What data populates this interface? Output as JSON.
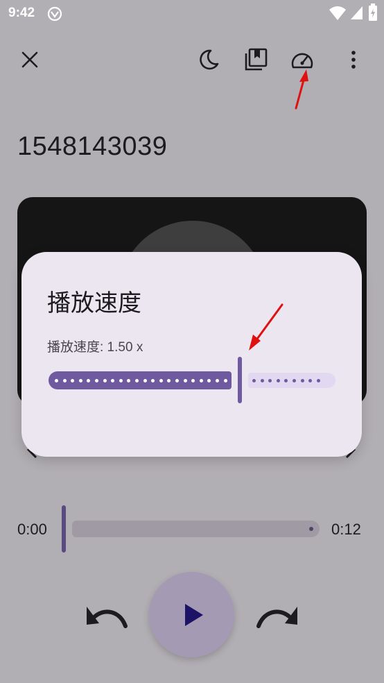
{
  "status_bar": {
    "time": "9:42",
    "icons": [
      "vpn-icon",
      "wifi-icon",
      "signal-icon",
      "battery-charging-icon"
    ]
  },
  "toolbar": {
    "close_icon": "close-icon",
    "sleep_timer_icon": "moon-icon",
    "bookmarks_icon": "bookmark-icon",
    "speed_icon": "speedometer-icon",
    "more_icon": "more-vert-icon"
  },
  "recording": {
    "title": "1548143039"
  },
  "speed_dialog": {
    "title": "播放速度",
    "label": "播放速度: 1.50 x",
    "slider_level_fraction": 0.67
  },
  "player": {
    "elapsed": "0:00",
    "duration": "0:12",
    "progress_fraction": 0,
    "rewind_icon": "rewind-icon",
    "play_icon": "play-icon",
    "forward_icon": "forward-icon"
  },
  "colors": {
    "scrim_background": "#b2afb4",
    "dialog_surface": "#ebe6ef",
    "accent": "#6f5aa0",
    "annotation_arrow": "#e01010"
  }
}
